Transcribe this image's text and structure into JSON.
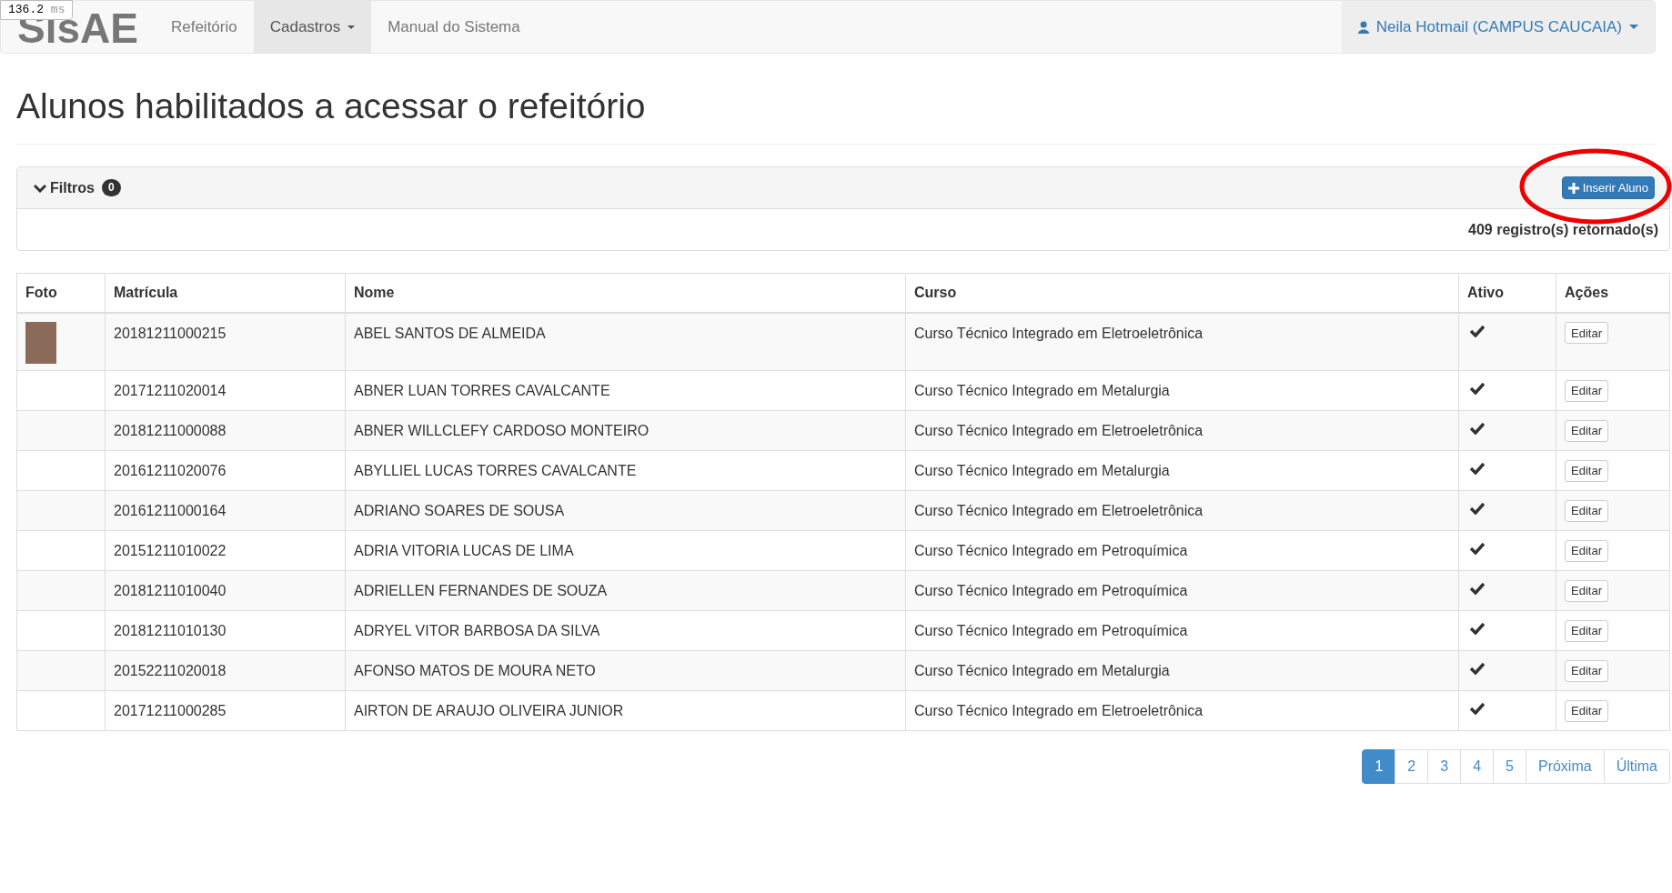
{
  "timer": {
    "value": "136.2",
    "unit": "ms"
  },
  "navbar": {
    "brand": "SisAE",
    "items": [
      {
        "label": "Refeitório",
        "selected": false,
        "dropdown": false
      },
      {
        "label": "Cadastros",
        "selected": true,
        "dropdown": true
      },
      {
        "label": "Manual do Sistema",
        "selected": false,
        "dropdown": false
      }
    ],
    "user": "Neila Hotmail (CAMPUS CAUCAIA)"
  },
  "page_title": "Alunos habilitados a acessar o refeitório",
  "filters": {
    "label": "Filtros",
    "count": "0",
    "expanded": true,
    "insert_button": "Inserir Aluno",
    "records": "409 registro(s) retornado(s)",
    "highlighted": true
  },
  "table": {
    "columns": [
      "Foto",
      "Matrícula",
      "Nome",
      "Curso",
      "Ativo",
      "Ações"
    ],
    "rows": [
      {
        "photo": true,
        "matricula": "20181211000215",
        "nome": "ABEL SANTOS DE ALMEIDA",
        "curso": "Curso Técnico Integrado em Eletroeletrônica",
        "ativo": true,
        "action": "Editar"
      },
      {
        "photo": false,
        "matricula": "20171211020014",
        "nome": "ABNER LUAN TORRES CAVALCANTE",
        "curso": "Curso Técnico Integrado em Metalurgia",
        "ativo": true,
        "action": "Editar"
      },
      {
        "photo": false,
        "matricula": "20181211000088",
        "nome": "ABNER WILLCLEFY CARDOSO MONTEIRO",
        "curso": "Curso Técnico Integrado em Eletroeletrônica",
        "ativo": true,
        "action": "Editar"
      },
      {
        "photo": false,
        "matricula": "20161211020076",
        "nome": "ABYLLIEL LUCAS TORRES CAVALCANTE",
        "curso": "Curso Técnico Integrado em Metalurgia",
        "ativo": true,
        "action": "Editar"
      },
      {
        "photo": false,
        "matricula": "20161211000164",
        "nome": "ADRIANO SOARES DE SOUSA",
        "curso": "Curso Técnico Integrado em Eletroeletrônica",
        "ativo": true,
        "action": "Editar"
      },
      {
        "photo": false,
        "matricula": "20151211010022",
        "nome": "ADRIA VITORIA LUCAS DE LIMA",
        "curso": "Curso Técnico Integrado em Petroquímica",
        "ativo": true,
        "action": "Editar"
      },
      {
        "photo": false,
        "matricula": "20181211010040",
        "nome": "ADRIELLEN FERNANDES DE SOUZA",
        "curso": "Curso Técnico Integrado em Petroquímica",
        "ativo": true,
        "action": "Editar"
      },
      {
        "photo": false,
        "matricula": "20181211010130",
        "nome": "ADRYEL VITOR BARBOSA DA SILVA",
        "curso": "Curso Técnico Integrado em Petroquímica",
        "ativo": true,
        "action": "Editar"
      },
      {
        "photo": false,
        "matricula": "20152211020018",
        "nome": "AFONSO MATOS DE MOURA NETO",
        "curso": "Curso Técnico Integrado em Metalurgia",
        "ativo": true,
        "action": "Editar"
      },
      {
        "photo": false,
        "matricula": "20171211000285",
        "nome": "AIRTON DE ARAUJO OLIVEIRA JUNIOR",
        "curso": "Curso Técnico Integrado em Eletroeletrônica",
        "ativo": true,
        "action": "Editar"
      }
    ]
  },
  "pagination": [
    {
      "label": "1",
      "selected": true
    },
    {
      "label": "2",
      "selected": false
    },
    {
      "label": "3",
      "selected": false
    },
    {
      "label": "4",
      "selected": false
    },
    {
      "label": "5",
      "selected": false
    },
    {
      "label": "Próxima",
      "selected": false
    },
    {
      "label": "Última",
      "selected": false
    }
  ]
}
